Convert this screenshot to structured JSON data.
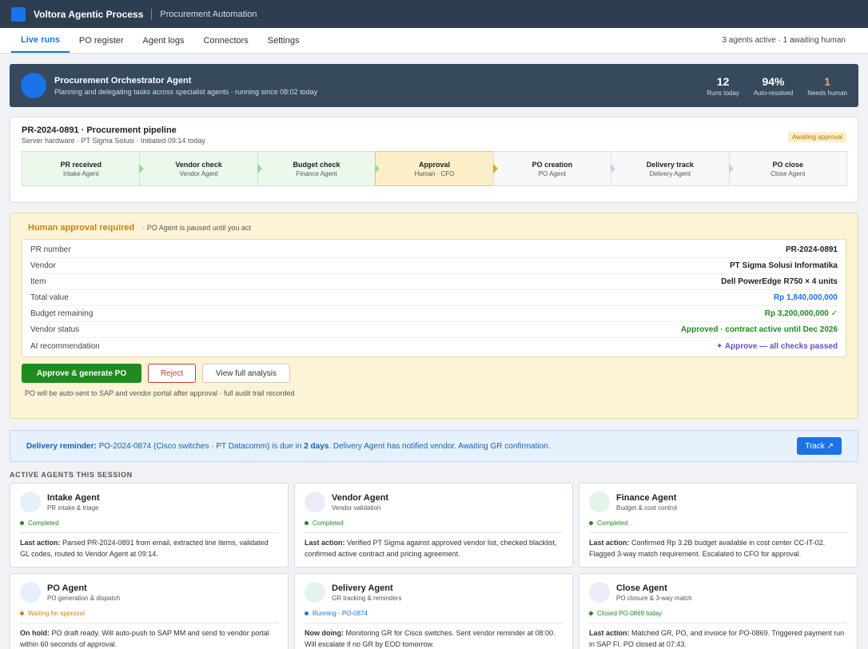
{
  "app": {
    "brand": "Voltora Agentic Process",
    "subtitle": "Procurement Automation"
  },
  "nav": {
    "tabs": [
      "Live runs",
      "PO register",
      "Agent logs",
      "Connectors",
      "Settings"
    ],
    "status": "3 agents active · 1 awaiting human"
  },
  "orchestrator": {
    "title": "Procurement Orchestrator Agent",
    "subtitle": "Planning and delegating tasks across specialist agents · running since 08:02 today",
    "stats": [
      {
        "value": "12",
        "label": "Runs today"
      },
      {
        "value": "94%",
        "label": "Auto-resolved"
      },
      {
        "value": "1",
        "label": "Needs human"
      }
    ]
  },
  "pipeline": {
    "title": "PR-2024-0891 · Procurement pipeline",
    "subtitle": "Server hardware · PT Sigma Solusi · Initiated 09:14 today",
    "badge": "Awaiting approval",
    "stages": [
      {
        "name": "PR received",
        "owner": "Intake Agent",
        "state": "done"
      },
      {
        "name": "Vendor check",
        "owner": "Vendor Agent",
        "state": "done"
      },
      {
        "name": "Budget check",
        "owner": "Finance Agent",
        "state": "done"
      },
      {
        "name": "Approval",
        "owner": "Human · CFO",
        "state": "current"
      },
      {
        "name": "PO creation",
        "owner": "PO Agent",
        "state": "pending"
      },
      {
        "name": "Delivery track",
        "owner": "Delivery Agent",
        "state": "pending"
      },
      {
        "name": "PO close",
        "owner": "Close Agent",
        "state": "pending"
      }
    ]
  },
  "approval": {
    "title": "Human approval required",
    "note": "· PO Agent is paused until you act",
    "rows": [
      {
        "key": "PR number",
        "value": "PR-2024-0891",
        "tone": ""
      },
      {
        "key": "Vendor",
        "value": "PT Sigma Solusi Informatika",
        "tone": ""
      },
      {
        "key": "Item",
        "value": "Dell PowerEdge R750 × 4 units",
        "tone": ""
      },
      {
        "key": "Total value",
        "value": "Rp 1,840,000,000",
        "tone": "blue"
      },
      {
        "key": "Budget remaining",
        "value": "Rp 3,200,000,000 ✓",
        "tone": "green"
      },
      {
        "key": "Vendor status",
        "value": "Approved · contract active until Dec 2026",
        "tone": "green"
      },
      {
        "key": "AI recommendation",
        "value": "✦ Approve — all checks passed",
        "tone": "purple"
      }
    ],
    "approve_label": "Approve & generate PO",
    "reject_label": "Reject",
    "view_label": "View full analysis",
    "footnote": "PO will be auto-sent to SAP and vendor portal after approval · full audit trail recorded"
  },
  "reminder": {
    "lead": "Delivery reminder:",
    "text_a": " PO-2024-0874 (Cisco switches · PT Datacomm) is due in ",
    "emph": "2 days",
    "text_b": ". Delivery Agent has notified vendor. Awaiting GR confirmation.",
    "button": "Track ↗"
  },
  "agents_section": "ACTIVE AGENTS THIS SESSION",
  "agents": [
    {
      "name": "Intake Agent",
      "role": "PR intake & triage",
      "status": "Completed",
      "status_color": "#1e8c1e",
      "avatar_color": "#e6f0fb",
      "desc_label": "Last action:",
      "desc": " Parsed PR-2024-0891 from email, extracted line items, validated GL codes, routed to Vendor Agent at 09:14."
    },
    {
      "name": "Vendor Agent",
      "role": "Vendor validation",
      "status": "Completed",
      "status_color": "#1e8c1e",
      "avatar_color": "#efeaf8",
      "desc_label": "Last action:",
      "desc": " Verified PT Sigma against approved vendor list, checked blacklist, confirmed active contract and pricing agreement."
    },
    {
      "name": "Finance Agent",
      "role": "Budget & cost control",
      "status": "Completed",
      "status_color": "#1e8c1e",
      "avatar_color": "#e3f4ea",
      "desc_label": "Last action:",
      "desc": " Confirmed Rp 3.2B budget available in cost center CC-IT-02. Flagged 3-way match requirement. Escalated to CFO for approval."
    },
    {
      "name": "PO Agent",
      "role": "PO generation & dispatch",
      "status": "Waiting for approval",
      "status_color": "#c8860b",
      "avatar_color": "#e6f0fb",
      "desc_label": "On hold:",
      "desc": " PO draft ready. Will auto-push to SAP MM and send to vendor portal within 60 seconds of approval."
    },
    {
      "name": "Delivery Agent",
      "role": "GR tracking & reminders",
      "status": "Running · PO-0874",
      "status_color": "#1a73e8",
      "avatar_color": "#e3f4ea",
      "desc_label": "Now doing:",
      "desc": " Monitoring GR for Cisco switches. Sent vendor reminder at 08:00. Will escalate if no GR by EOD tomorrow."
    },
    {
      "name": "Close Agent",
      "role": "PO closure & 3-way match",
      "status": "Closed PO-0869 today",
      "status_color": "#1e8c1e",
      "avatar_color": "#efeaf8",
      "desc_label": "Last action:",
      "desc": " Matched GR, PO, and invoice for PO-0869. Triggered payment run in SAP FI. PO closed at 07:43."
    }
  ]
}
